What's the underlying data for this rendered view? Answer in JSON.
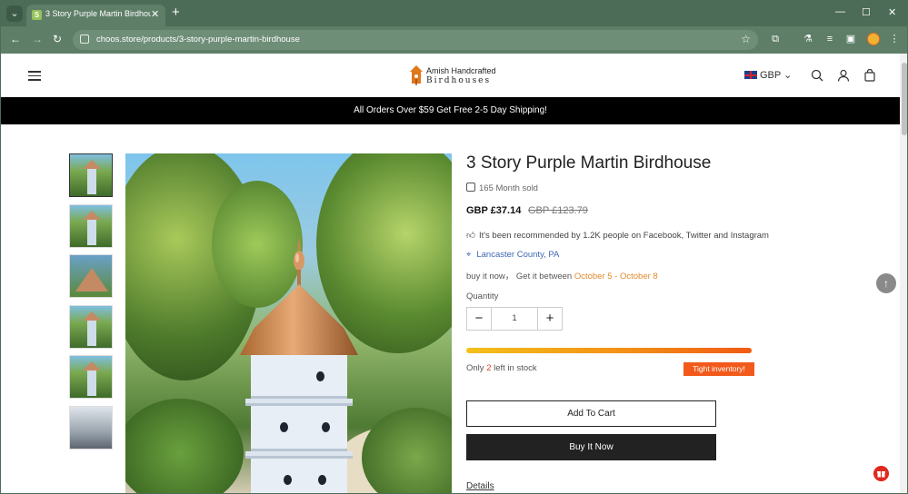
{
  "browser": {
    "tab_title": "3 Story Purple Martin Birdhouse",
    "url": "choos.store/products/3-story-purple-martin-birdhouse"
  },
  "header": {
    "logo_line1": "Amish Handcrafted",
    "logo_line2": "Birdhouses",
    "currency": "GBP"
  },
  "banner": {
    "text": "All Orders Over $59 Get Free 2-5 Day Shipping!"
  },
  "product": {
    "title": "3 Story Purple Martin Birdhouse",
    "sold": "165 Month sold",
    "price": "GBP £37.14",
    "old_price": "GBP £123.79",
    "recommendation": "It's been recommended by 1.2K people on Facebook, Twitter and Instagram",
    "location": "Lancaster County, PA",
    "delivery_prefix": "buy it now， Get it between",
    "delivery_start": "October 5",
    "delivery_sep": "-",
    "delivery_end": "October 8",
    "quantity_label": "Quantity",
    "quantity": "1",
    "stock_prefix": "Only",
    "stock_count": "2",
    "stock_suffix": "left in stock",
    "stock_level": 1.0,
    "inventory_badge": "Tight inventory!",
    "add_to_cart": "Add To Cart",
    "buy_now": "Buy It Now",
    "details_tab": "Details"
  },
  "colors": {
    "chrome": "#4c6c57",
    "accent_orange": "#f25a1b",
    "location_blue": "#3e67b5"
  }
}
